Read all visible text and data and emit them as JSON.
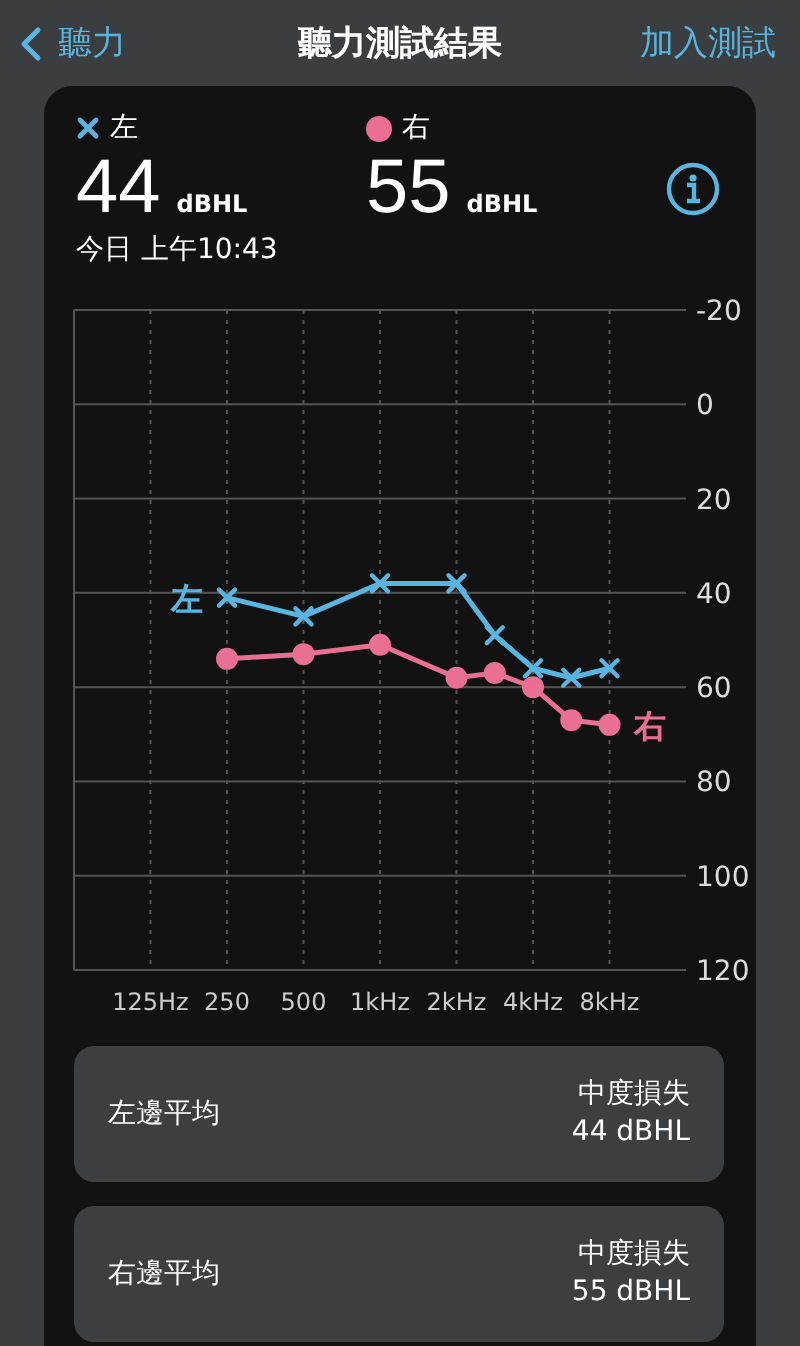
{
  "nav": {
    "back_label": "聽力",
    "title": "聽力測試結果",
    "action": "加入測試"
  },
  "ears": [
    {
      "kind": "cross",
      "label": "左",
      "color": "#5ab4e0",
      "value": "44",
      "unit": "dBHL"
    },
    {
      "kind": "dot",
      "label": "右",
      "color": "#ea7093",
      "value": "55",
      "unit": "dBHL"
    }
  ],
  "timestamp": "今日 上午10:43",
  "chart_data": {
    "type": "line",
    "categories": [
      "125Hz",
      null,
      "250",
      null,
      "500",
      null,
      "1kHz",
      null,
      "2kHz",
      null,
      "4kHz",
      null,
      "8kHz"
    ],
    "series": [
      {
        "name": "左",
        "color": "#5ab4e0",
        "marker": "x",
        "values": [
          null,
          null,
          41,
          null,
          45,
          null,
          38,
          null,
          38,
          49,
          56,
          58,
          56
        ]
      },
      {
        "name": "右",
        "color": "#ea7093",
        "marker": "o",
        "values": [
          null,
          null,
          54,
          null,
          53,
          null,
          51,
          null,
          58,
          57,
          60,
          67,
          68
        ]
      }
    ],
    "ylim": [
      120,
      -20
    ],
    "grid": true,
    "yticks": [
      -20,
      0,
      20,
      40,
      60,
      80,
      100,
      120
    ]
  },
  "summaries": [
    {
      "label": "左邊平均",
      "grade": "中度損失",
      "value": "44 dBHL"
    },
    {
      "label": "右邊平均",
      "grade": "中度損失",
      "value": "55 dBHL"
    }
  ]
}
